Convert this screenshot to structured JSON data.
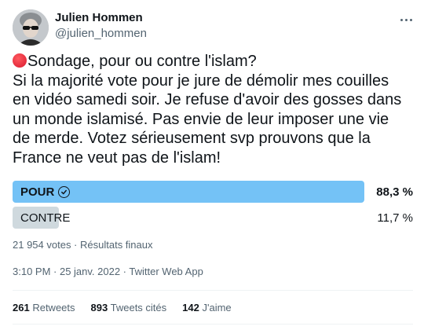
{
  "author": {
    "name": "Julien Hommen",
    "handle": "@julien_hommen"
  },
  "tweet": {
    "emoji": "red-circle",
    "lines": [
      "Sondage, pour ou contre l'islam?",
      "Si la majorité vote pour je jure de démolir mes couilles",
      "en vidéo samedi soir. Je refuse d'avoir des gosses dans",
      "un monde islamisé. Pas envie de leur imposer une vie",
      "de merde. Votez sérieusement svp prouvons que la",
      "France ne veut pas de l'islam!"
    ]
  },
  "poll": {
    "options": [
      {
        "label": "POUR",
        "percent": "88,3 %",
        "value": 88.3,
        "winner": true
      },
      {
        "label": "CONTRE",
        "percent": "11,7 %",
        "value": 11.7,
        "winner": false
      }
    ],
    "meta": "21 954 votes · Résultats finaux"
  },
  "timestamp": "3:10 PM · 25 janv. 2022 · Twitter Web App",
  "stats": {
    "retweets_count": "261",
    "retweets_label": "Retweets",
    "quotes_count": "893",
    "quotes_label": "Tweets cités",
    "likes_count": "142",
    "likes_label": "J'aime"
  },
  "colors": {
    "winner_bar": "#74c2f6",
    "loser_bar": "#cfd9de",
    "secondary_text": "#536471"
  }
}
